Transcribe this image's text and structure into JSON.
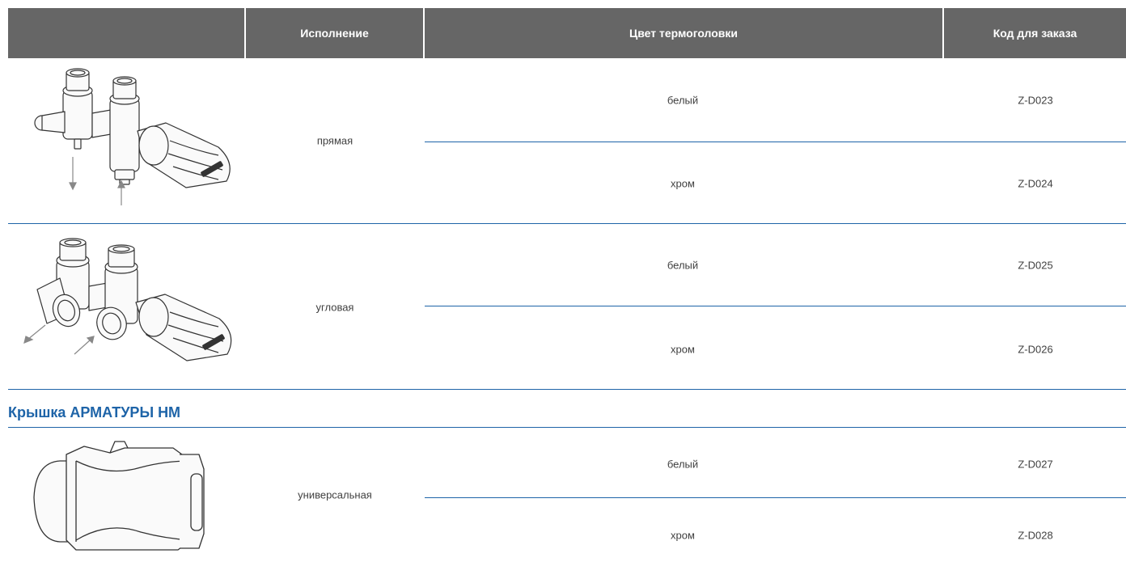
{
  "header": {
    "execution": "Исполнение",
    "color": "Цвет термоголовки",
    "code": "Код для заказа"
  },
  "groups": [
    {
      "image_icon": "straight-valve-with-thermohead",
      "execution": "прямая",
      "rows": [
        {
          "color": "белый",
          "code": "Z-D023"
        },
        {
          "color": "хром",
          "code": "Z-D024"
        }
      ]
    },
    {
      "image_icon": "angle-valve-with-thermohead",
      "execution": "угловая",
      "rows": [
        {
          "color": "белый",
          "code": "Z-D025"
        },
        {
          "color": "хром",
          "code": "Z-D026"
        }
      ]
    }
  ],
  "section": {
    "title": "Крышка АРМАТУРЫ HM",
    "image_icon": "fitting-cover",
    "execution": "универсальная",
    "rows": [
      {
        "color": "белый",
        "code": "Z-D027"
      },
      {
        "color": "хром",
        "code": "Z-D028"
      }
    ]
  },
  "colors": {
    "header_bg": "#666666",
    "header_text": "#ffffff",
    "divider": "#1e64a8",
    "section_title": "#1e64a8",
    "body_text": "#404040"
  }
}
